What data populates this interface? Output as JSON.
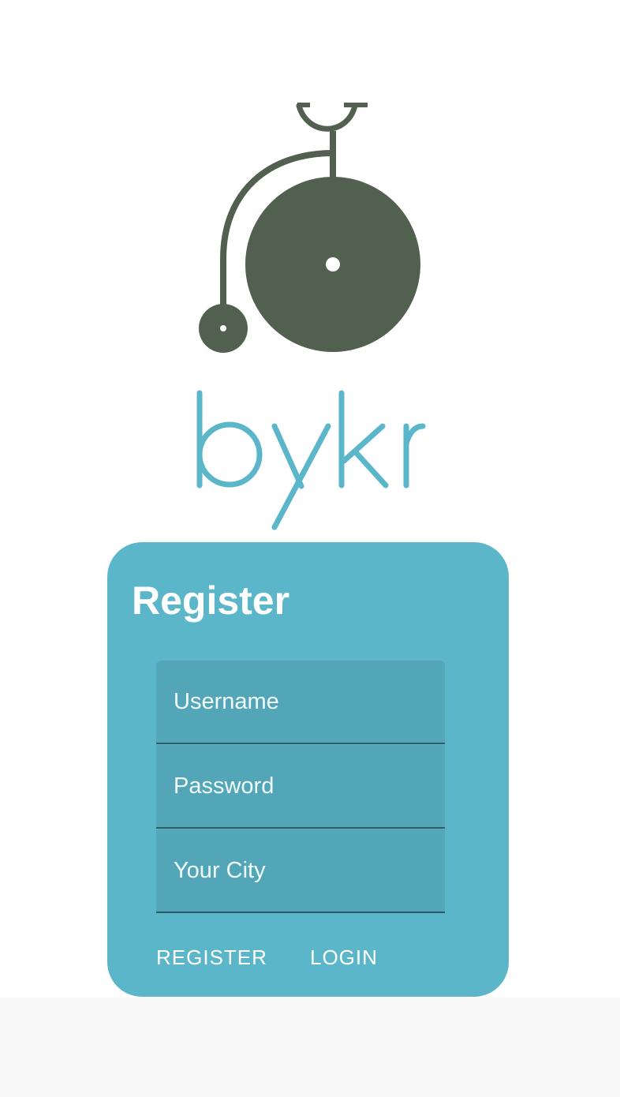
{
  "app": {
    "brand_name": "bykr"
  },
  "brand_colors": {
    "logo_icon": "#52604f",
    "logo_text": "#5bb6c9",
    "card_background": "#5bb6c9",
    "field_background": "#52a6b7"
  },
  "register_card": {
    "title": "Register",
    "fields": {
      "username": {
        "value": "",
        "placeholder": "Username"
      },
      "password": {
        "value": "",
        "placeholder": "Password"
      },
      "city": {
        "value": "",
        "placeholder": "Your City"
      }
    },
    "buttons": {
      "register_label": "REGISTER",
      "login_label": "LOGIN"
    }
  }
}
